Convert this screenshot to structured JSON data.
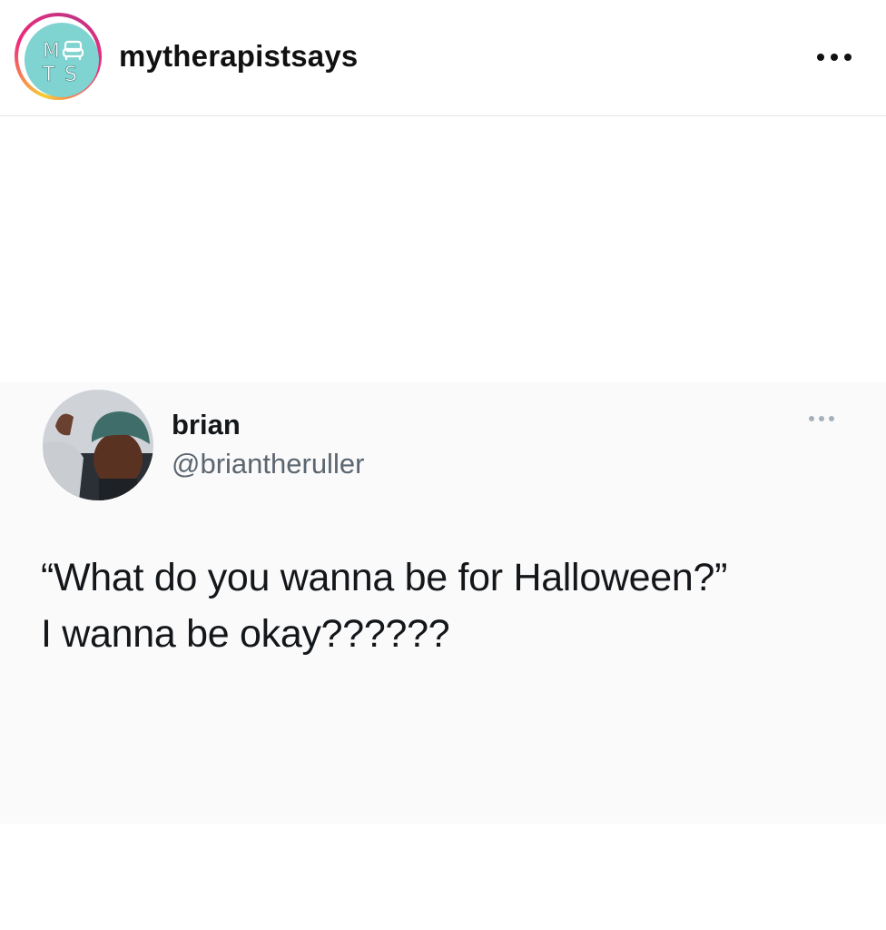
{
  "post": {
    "account": {
      "username": "mytherapistsays",
      "avatar_icon": "mts-logo-icon",
      "avatar_letters": [
        "M",
        "T",
        "S"
      ],
      "avatar_color": "#7fd3d1"
    },
    "more_icon": "more-horizontal-icon"
  },
  "tweet": {
    "display_name": "brian",
    "handle": "@briantheruller",
    "more_icon": "more-horizontal-icon",
    "text_lines": [
      "“What do you wanna be for Halloween?”",
      "I wanna be okay??????"
    ]
  }
}
